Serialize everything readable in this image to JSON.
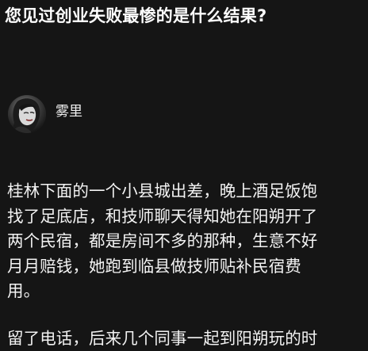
{
  "question": {
    "title": "您见过创业失败最惨的是什么结果?"
  },
  "author": {
    "name": "雾里",
    "avatar_icon": "user-avatar-photo"
  },
  "answer": {
    "paragraphs": [
      {
        "lines": [
          "桂林下面的一个小县城出差，晚上酒足饭饱",
          "找了足底店，和技师聊天得知她在阳朔开了",
          "两个民宿，都是房间不多的那种，生意不好",
          "月月赔钱，她跑到临县做技师贴补民宿费",
          "用。"
        ]
      },
      {
        "lines": [
          "留了电话，后来几个同事一起到阳朔玩的时"
        ]
      }
    ]
  },
  "colors": {
    "background": "#151515",
    "text": "#f3f3f3",
    "title": "#ffffff"
  }
}
